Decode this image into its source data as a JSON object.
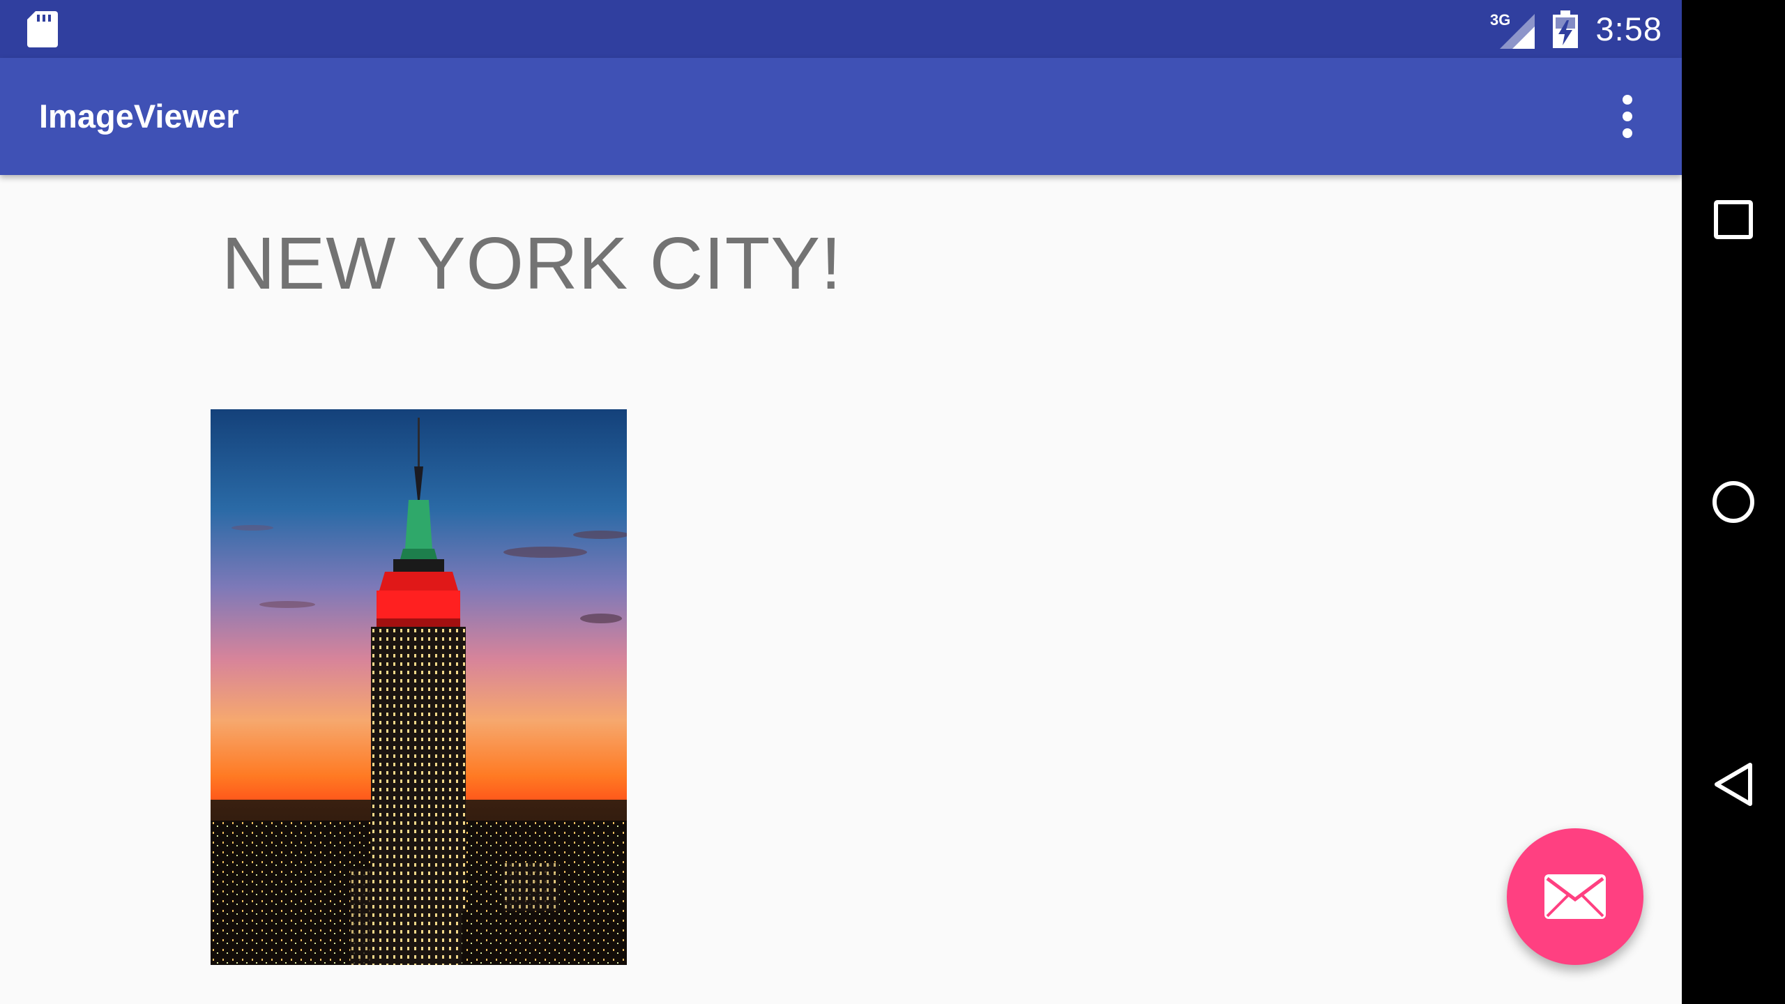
{
  "status_bar": {
    "network_label": "3G",
    "time": "3:58",
    "icons": [
      "sd-card-icon",
      "signal-icon",
      "battery-charging-icon"
    ]
  },
  "app_bar": {
    "title": "ImageViewer",
    "menu_icon": "overflow-menu-icon"
  },
  "content": {
    "headline": "NEW YORK CITY!",
    "image_description_icon": "empire-state-building-photo"
  },
  "fab": {
    "icon": "email-icon",
    "color": "#ff4081"
  },
  "nav_bar": {
    "buttons": [
      "recents-icon",
      "home-icon",
      "back-icon"
    ]
  },
  "colors": {
    "status_bar": "#303f9f",
    "app_bar": "#3f51b5",
    "accent": "#ff4081",
    "background": "#fafafa",
    "headline_text": "#737373"
  }
}
